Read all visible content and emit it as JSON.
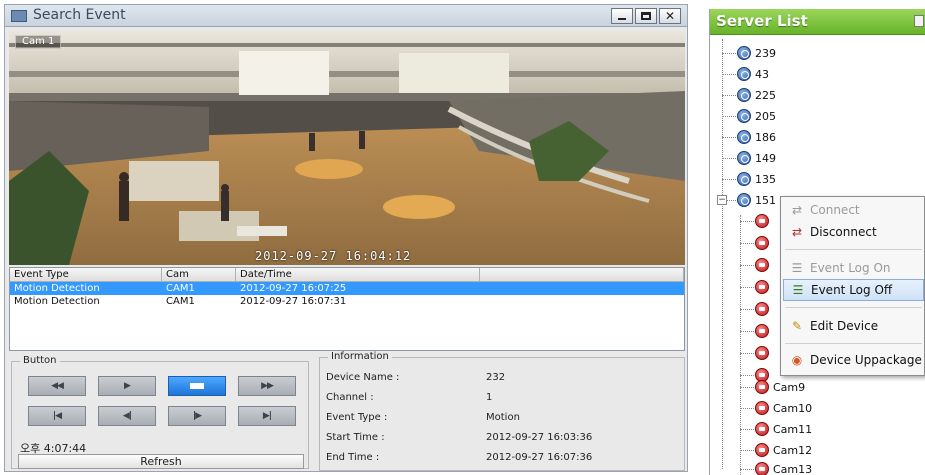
{
  "window": {
    "title": "Search Event",
    "controls": {
      "minimize": "_",
      "maximize": "□",
      "close": "×"
    }
  },
  "video": {
    "camera_label": "Cam 1",
    "timestamp": "2012-09-27 16:04:12"
  },
  "event_list": {
    "columns": [
      "Event Type",
      "Cam",
      "Date/Time"
    ],
    "rows": [
      {
        "type": "Motion Detection",
        "cam": "CAM1",
        "datetime": "2012-09-27 16:07:25",
        "selected": true
      },
      {
        "type": "Motion Detection",
        "cam": "CAM1",
        "datetime": "2012-09-27 16:07:31",
        "selected": false
      }
    ]
  },
  "buttons": {
    "group_label": "Button",
    "row1": [
      "◀◀",
      "▶",
      "■",
      "▶▶"
    ],
    "row2": [
      "|◀",
      "◀|",
      "|▶",
      "▶|"
    ],
    "clock": "오후 4:07:44",
    "refresh_label": "Refresh"
  },
  "information": {
    "group_label": "Information",
    "fields": [
      {
        "key": "Device Name :",
        "value": "232"
      },
      {
        "key": "Channel :",
        "value": "1"
      },
      {
        "key": "Event Type :",
        "value": "Motion"
      },
      {
        "key": "Start Time :",
        "value": "2012-09-27 16:03:36"
      },
      {
        "key": "End Time :",
        "value": "2012-09-27 16:07:36"
      }
    ]
  },
  "server_list": {
    "title": "Server List",
    "servers": [
      "239",
      "43",
      "225",
      "205",
      "186",
      "149",
      "135",
      "151"
    ],
    "cameras": [
      "Cam9",
      "Cam10",
      "Cam11",
      "Cam12",
      "Cam13"
    ]
  },
  "context_menu": {
    "items": [
      {
        "label": "Connect",
        "disabled": true,
        "highlighted": false
      },
      {
        "label": "Disconnect",
        "disabled": false,
        "highlighted": false
      },
      {
        "label": "Event Log On",
        "disabled": true,
        "highlighted": false
      },
      {
        "label": "Event Log Off",
        "disabled": false,
        "highlighted": true
      },
      {
        "label": "Edit Device",
        "disabled": false,
        "highlighted": false
      },
      {
        "label": "Device Uppackage",
        "disabled": false,
        "highlighted": false
      }
    ]
  },
  "colors": {
    "selection": "#3399ff",
    "server_header": "#67b32a",
    "active_button": "#1e74d8"
  }
}
